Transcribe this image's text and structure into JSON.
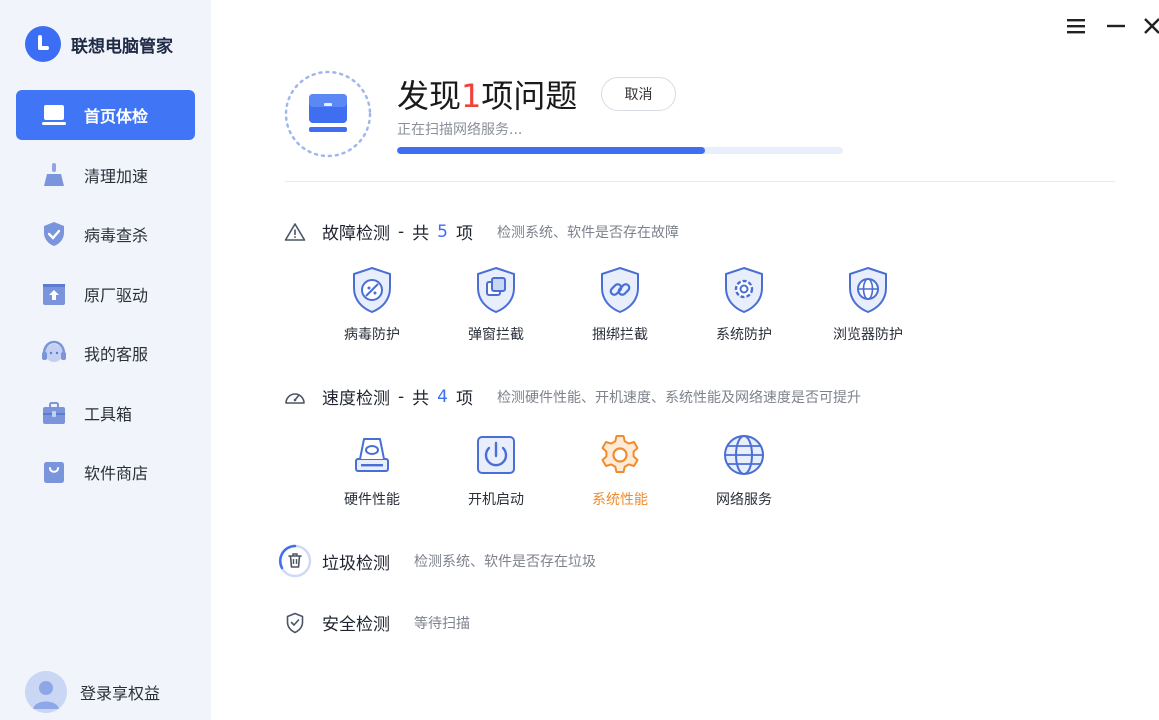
{
  "app": {
    "title": "联想电脑管家"
  },
  "sidebar": {
    "items": [
      {
        "label": "首页体检",
        "icon": "laptop-icon",
        "active": true
      },
      {
        "label": "清理加速",
        "icon": "broom-icon",
        "active": false
      },
      {
        "label": "病毒查杀",
        "icon": "shield-check-icon",
        "active": false
      },
      {
        "label": "原厂驱动",
        "icon": "upload-box-icon",
        "active": false
      },
      {
        "label": "我的客服",
        "icon": "headset-icon",
        "active": false
      },
      {
        "label": "工具箱",
        "icon": "toolbox-icon",
        "active": false
      },
      {
        "label": "软件商店",
        "icon": "shopping-bag-icon",
        "active": false
      }
    ],
    "login_label": "登录享权益"
  },
  "window_controls": {
    "menu": "menu-icon",
    "minimize": "minimize-icon",
    "close": "close-icon"
  },
  "header": {
    "title_prefix": "发现",
    "issue_count": "1",
    "title_suffix": "项问题",
    "cancel_label": "取消",
    "status": "正在扫描网络服务...",
    "progress": 0.69
  },
  "sections": {
    "fault": {
      "name": "故障检测",
      "sep": "-",
      "total_prefix": "共",
      "count": "5",
      "unit": "项",
      "desc": "检测系统、软件是否存在故障",
      "items": [
        {
          "label": "病毒防护",
          "icon": "virus-shield-icon"
        },
        {
          "label": "弹窗拦截",
          "icon": "popup-shield-icon"
        },
        {
          "label": "捆绑拦截",
          "icon": "link-shield-icon"
        },
        {
          "label": "系统防护",
          "icon": "gear-shield-icon"
        },
        {
          "label": "浏览器防护",
          "icon": "globe-shield-icon"
        }
      ]
    },
    "speed": {
      "name": "速度检测",
      "sep": "-",
      "total_prefix": "共",
      "count": "4",
      "unit": "项",
      "desc": "检测硬件性能、开机速度、系统性能及网络速度是否可提升",
      "items": [
        {
          "label": "硬件性能",
          "icon": "hardware-icon"
        },
        {
          "label": "开机启动",
          "icon": "power-icon"
        },
        {
          "label": "系统性能",
          "icon": "gear-icon",
          "active": true
        },
        {
          "label": "网络服务",
          "icon": "globe-icon"
        }
      ]
    },
    "junk": {
      "name": "垃圾检测",
      "desc": "检测系统、软件是否存在垃圾"
    },
    "security": {
      "name": "安全检测",
      "desc": "等待扫描"
    }
  },
  "colors": {
    "accent": "#3d6ff0",
    "warning": "#f08c2e",
    "danger": "#f0413a",
    "sidebar_bg": "#f1f4fb"
  }
}
